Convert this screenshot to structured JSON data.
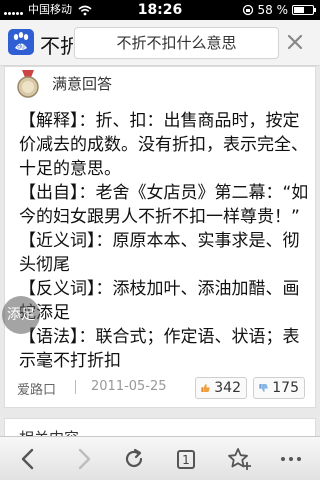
{
  "status_bar": {
    "carrier": "中国移动",
    "time": "18:26",
    "battery": "58 %",
    "battery_level": 0.58
  },
  "nav": {
    "title_short": "不折",
    "search_text": "不折不扣什么意思",
    "icons": {
      "logo": "baidu-paw-icon",
      "close": "close-icon"
    }
  },
  "answer": {
    "header": "满意回答",
    "paragraphs": [
      "【解释】：折、扣：出售商品时，按定价减去的成数。没有折扣，表示完全、十足的意思。",
      "【出自】：老舍《女店员》第二幕：“如今的妇女跟男人不折不扣一样尊贵！”",
      "【近义词】：原原本本、实事求是、彻头彻尾",
      "【反义词】：添枝加叶、添油加醋、画蛇添足",
      "【语法】：联合式；作定语、状语；表示毫不打折扣"
    ],
    "author": "爱路口",
    "date": "2011-05-25",
    "votes_up": "342",
    "votes_down": "175"
  },
  "float_button": {
    "label": "添足"
  },
  "next_card": {
    "title": "相关内容"
  },
  "toolbar": {
    "tab_count": "1",
    "icons": [
      "back-icon",
      "forward-icon",
      "refresh-icon",
      "tabs-icon",
      "add-favorite-icon",
      "more-icon"
    ]
  }
}
